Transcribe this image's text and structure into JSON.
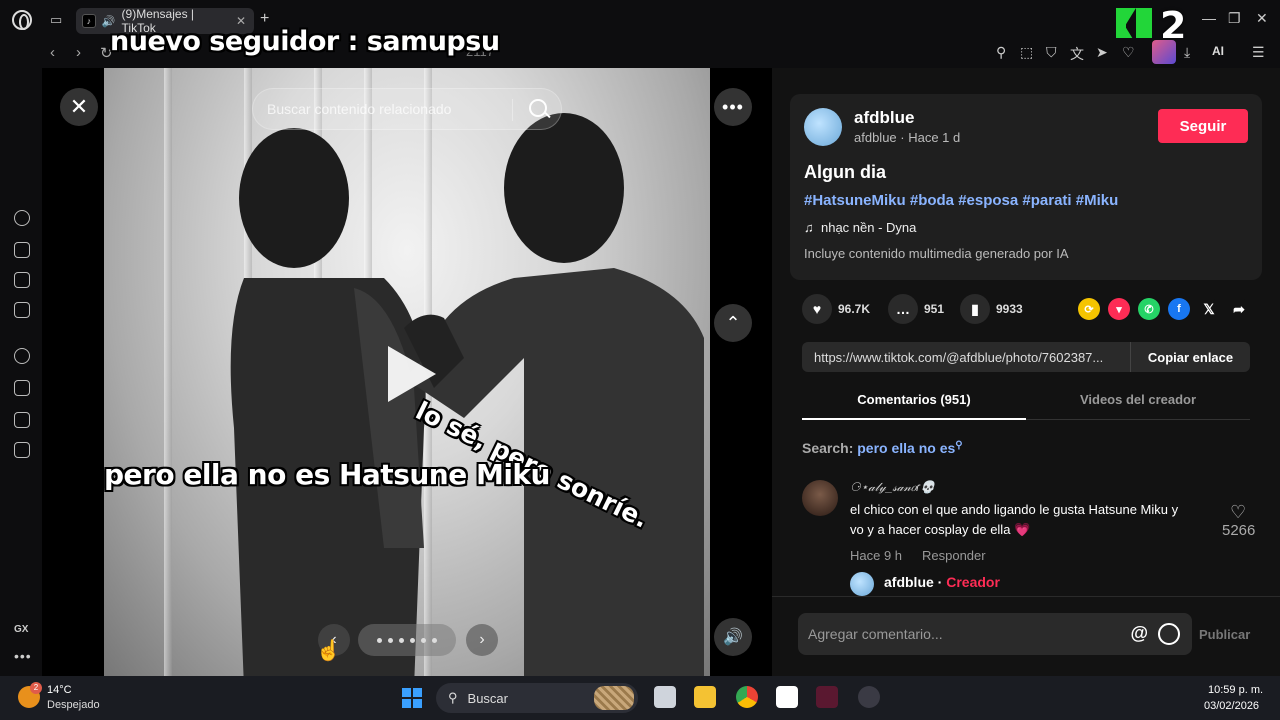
{
  "browser": {
    "tab_title": "(9)Mensajes | TikTok",
    "url_fragment": "2117",
    "overlay_title": "nuevo seguidor : samupsu",
    "ai_label": "AI",
    "badge_number": "2",
    "sidebar_gx": "GX"
  },
  "video": {
    "search_placeholder": "Buscar contenido relacionado",
    "caption_top": "lo sé, pero sonríe.",
    "caption_bottom": "pero ella no es Hatsune Miku",
    "slide_count": 6
  },
  "post": {
    "author_name": "afdblue",
    "author_meta": "afdblue · Hace 1 d",
    "follow_label": "Seguir",
    "title": "Algun dia",
    "hashtags": "#HatsuneMiku #boda #esposa #parati #Miku",
    "music": "nhạc nền - Dyna",
    "ai_note": "Incluye contenido multimedia generado por IA",
    "likes": "96.7K",
    "comments": "951",
    "saves": "9933",
    "link": "https://www.tiktok.com/@afdblue/photo/7602387...",
    "copy_label": "Copiar enlace"
  },
  "tabs": {
    "comments": "Comentarios (951)",
    "creator_videos": "Videos del creador"
  },
  "search_tip": {
    "prefix": "Search: ",
    "query": "pero ella no es"
  },
  "comment": {
    "user": "⚆⋆𝒶𝓁𝓎_𝓈𝒶𝓃𝑜ɾ💀",
    "text": "el chico con el que ando ligando le gusta Hatsune Miku y vo y a hacer cosplay de ella 💗",
    "time": "Hace 9 h",
    "reply_label": "Responder",
    "likes": "5266",
    "reply_user": "afdblue",
    "reply_tag": "Creador"
  },
  "composer": {
    "placeholder": "Agregar comentario...",
    "publish_label": "Publicar"
  },
  "taskbar": {
    "weather_temp": "14°C",
    "weather_desc": "Despejado",
    "weather_badge": "2",
    "search_label": "Buscar",
    "time": "10:59 p. m.",
    "date": "03/02/2026"
  },
  "colors": {
    "accent": "#fe2c55",
    "hashtag": "#8ab4ff"
  }
}
